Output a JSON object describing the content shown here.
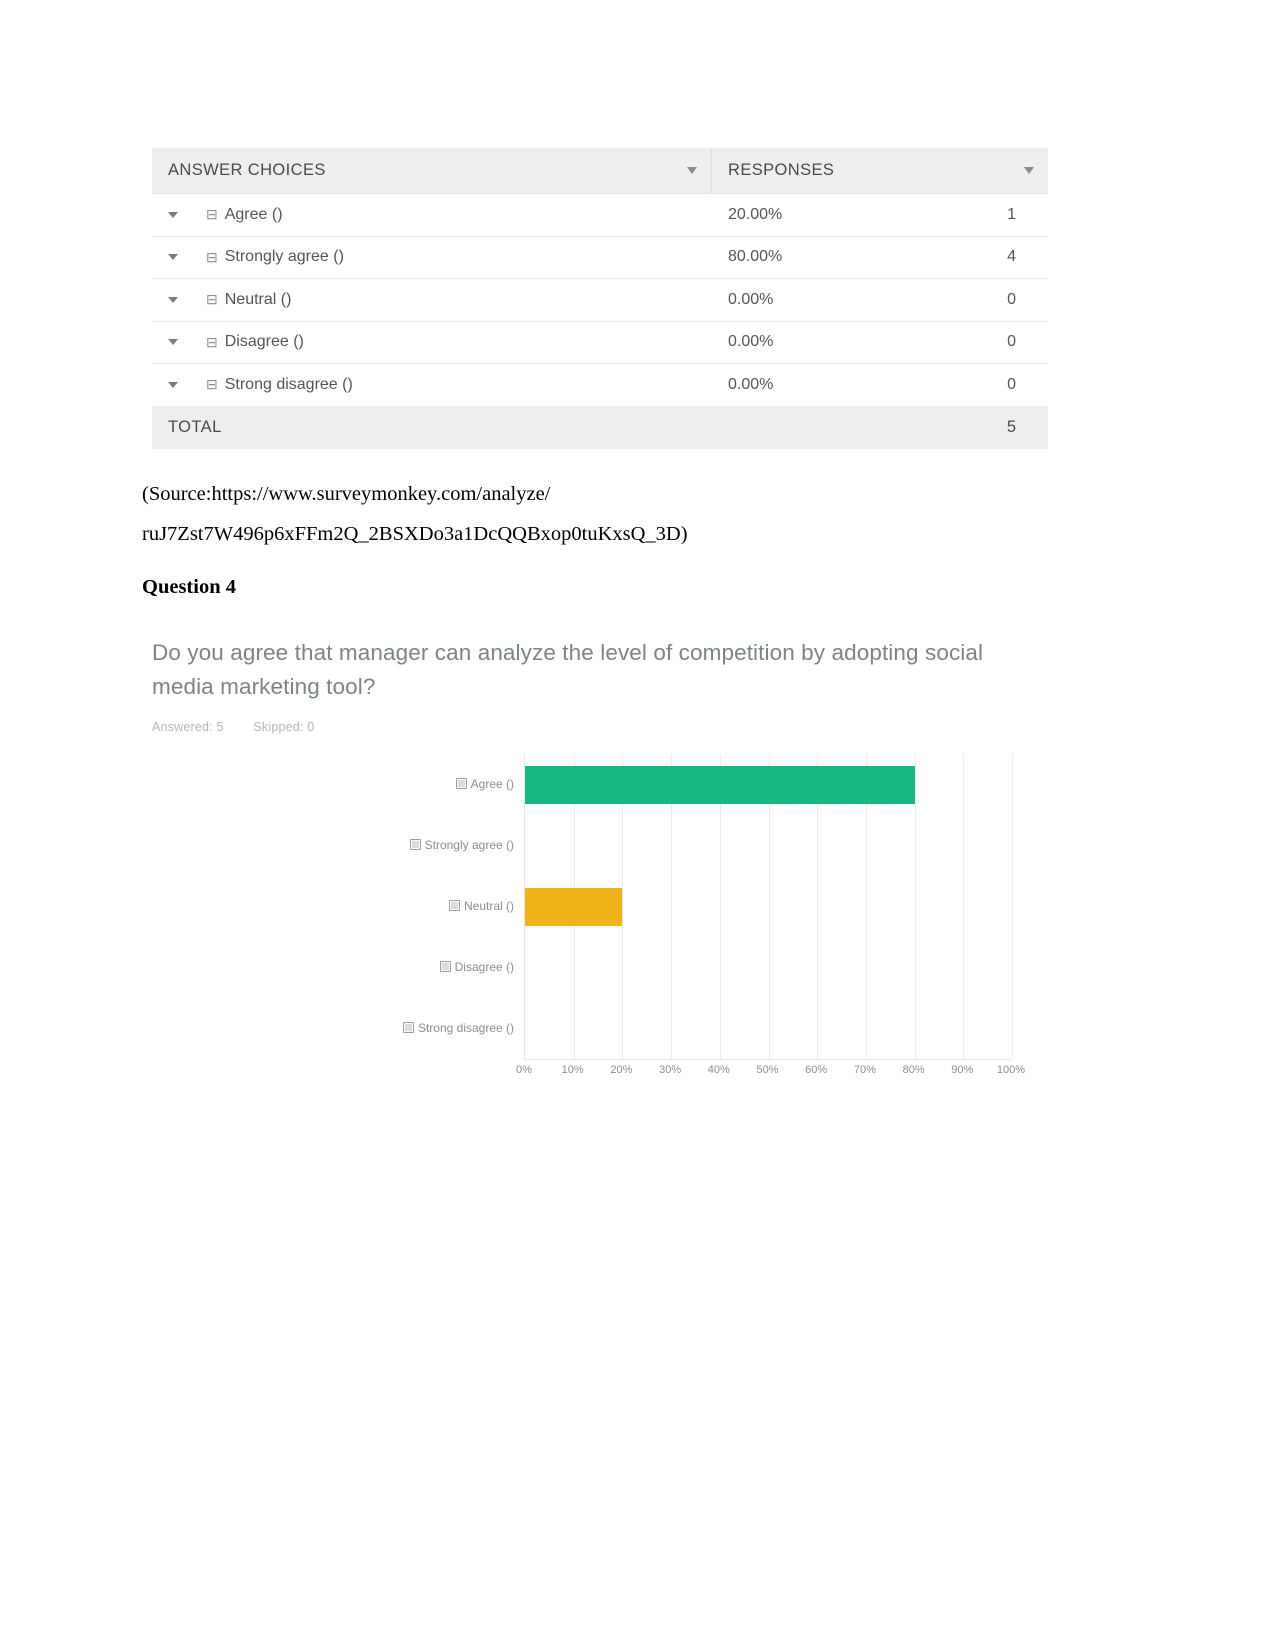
{
  "results_table": {
    "columns": [
      {
        "label": "ANSWER CHOICES",
        "sort_icon": "chevron-down-icon"
      },
      {
        "label": "RESPONSES",
        "sort_icon": "chevron-down-icon"
      }
    ],
    "rows": [
      {
        "choice": "Agree ()",
        "percent": "20.00%",
        "count": "1"
      },
      {
        "choice": "Strongly agree ()",
        "percent": "80.00%",
        "count": "4"
      },
      {
        "choice": "Neutral ()",
        "percent": "0.00%",
        "count": "0"
      },
      {
        "choice": "Disagree ()",
        "percent": "0.00%",
        "count": "0"
      },
      {
        "choice": "Strong disagree ()",
        "percent": "0.00%",
        "count": "0"
      }
    ],
    "total": {
      "label": "TOTAL",
      "count": "5"
    }
  },
  "source": {
    "line1": "(Source:https://www.surveymonkey.com/analyze/",
    "line2": "ruJ7Zst7W496p6xFFm2Q_2BSXDo3a1DcQQBxop0tuKxsQ_3D)"
  },
  "question_heading": "Question 4",
  "survey": {
    "title": "Do you agree that manager can analyze the level of competition by adopting social media marketing tool?",
    "answered_label": "Answered: 5",
    "skipped_label": "Skipped: 0"
  },
  "chart_data": {
    "type": "bar",
    "orientation": "horizontal",
    "title": "Do you agree that manager can analyze the level of competition by adopting social media marketing tool?",
    "categories": [
      "Agree ()",
      "Strongly agree ()",
      "Neutral ()",
      "Disagree ()",
      "Strong disagree ()"
    ],
    "values": [
      80,
      0,
      20,
      0,
      0
    ],
    "bar_colors": [
      "#18b981",
      "#18b981",
      "#f0b419",
      "#18b981",
      "#18b981"
    ],
    "xlabel": "",
    "ylabel": "",
    "xlim": [
      0,
      100
    ],
    "xticks": [
      0,
      10,
      20,
      30,
      40,
      50,
      60,
      70,
      80,
      90,
      100
    ],
    "xtick_labels": [
      "0%",
      "10%",
      "20%",
      "30%",
      "40%",
      "50%",
      "60%",
      "70%",
      "80%",
      "90%",
      "100%"
    ],
    "grid": true,
    "legend": "none",
    "colors": {
      "green": "#18b981",
      "amber": "#f0b419",
      "gridline": "#eceeed",
      "axis": "#e4e6e5",
      "tick_text": "#8a8f8c"
    }
  }
}
